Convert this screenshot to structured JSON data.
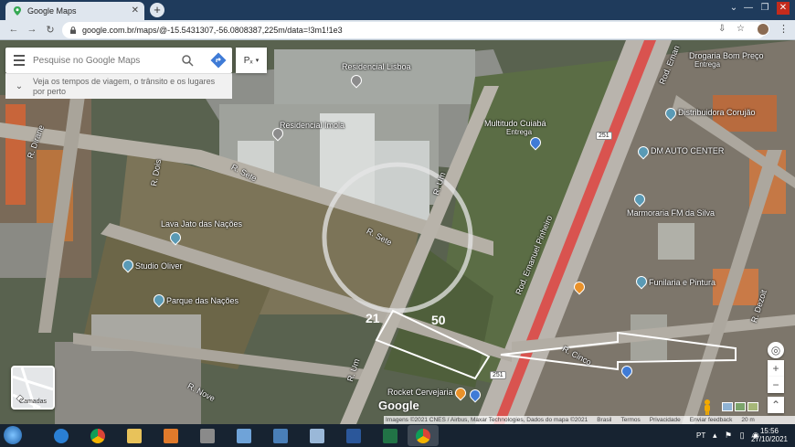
{
  "browser": {
    "tab_title": "Google Maps",
    "tab_close": "✕",
    "new_tab": "+",
    "url": "google.com.br/maps/@-15.5431307,-56.0808387,225m/data=!3m1!1e3",
    "window_controls": {
      "minimize": "—",
      "maximize": "❐",
      "close": "✕"
    }
  },
  "maps": {
    "search_placeholder": "Pesquise no Google Maps",
    "layer_dropdown": "Pₓ",
    "travel_times_text": "Veja os tempos de viagem, o trânsito e os lugares por perto",
    "layers_label": "Camadas",
    "google_logo": "Google",
    "places": [
      {
        "name": "Residencial Lisboa"
      },
      {
        "name": "Residencial Imola"
      },
      {
        "name": "Multitudo Cuiabá",
        "sub": "Entrega"
      },
      {
        "name": "Drogaria Bom Preço",
        "sub": "Entrega"
      },
      {
        "name": "Distribuidora Corujão"
      },
      {
        "name": "DM AUTO CENTER"
      },
      {
        "name": "Marmoraria FM da Silva"
      },
      {
        "name": "Lava Jato das Nações"
      },
      {
        "name": "Studio Oliver"
      },
      {
        "name": "Parque das Nações"
      },
      {
        "name": "Funilaria e Pintura"
      },
      {
        "name": "Rocket Cervejaria"
      }
    ],
    "roads": {
      "r_sete_1": "R. Sete",
      "r_sete_2": "R. Sete",
      "r_um_1": "R. Um",
      "r_um_2": "R. Um",
      "r_dois": "R. Dois",
      "r_nove": "R. Nove",
      "r_cinco": "R. Cinco",
      "r_dezoit": "R. Dezoit",
      "r_dirane": "R. Dirane",
      "rod_emanuel": "Rod. Emanuel Pinheiro",
      "rod_eman_top": "Rod. Eman",
      "shield_top": "251",
      "shield_bottom": "251"
    },
    "annotations": {
      "width_label": "21",
      "length_label": "50"
    },
    "attribution": [
      "Imagens ©2021 CNES / Airbus, Maxar Technologies, Dados do mapa ©2021",
      "Brasil",
      "Termos",
      "Privacidade",
      "Enviar feedback",
      "20 m"
    ],
    "controls": {
      "zoom_in": "+",
      "zoom_out": "−",
      "locate": "◎",
      "expand": "⌃"
    }
  },
  "taskbar": {
    "language": "PT",
    "time": "15:56",
    "date": "27/10/2021"
  },
  "colors": {
    "tab_bar": "#1f3b5c",
    "chrome_bg": "#dfe6ee",
    "taskbar": "#172331",
    "road_red": "#d9534f",
    "link_blue": "#3f7bd6"
  }
}
